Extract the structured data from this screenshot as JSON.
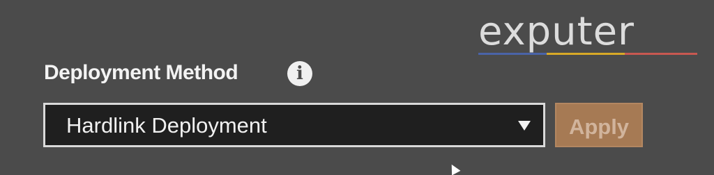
{
  "watermark": {
    "text": "exputer",
    "colors": [
      "#4a67b0",
      "#e4b224",
      "#d35a52"
    ]
  },
  "deployment": {
    "label": "Deployment Method",
    "info_icon": "info-icon",
    "info_text": "i",
    "selected_value": "Hardlink Deployment",
    "apply_label": "Apply"
  },
  "colors": {
    "background": "#4b4b4b",
    "select_background": "#1f1f1f",
    "select_border": "#dadada",
    "apply_background": "#a67a54",
    "apply_text": "#d1b49c"
  }
}
